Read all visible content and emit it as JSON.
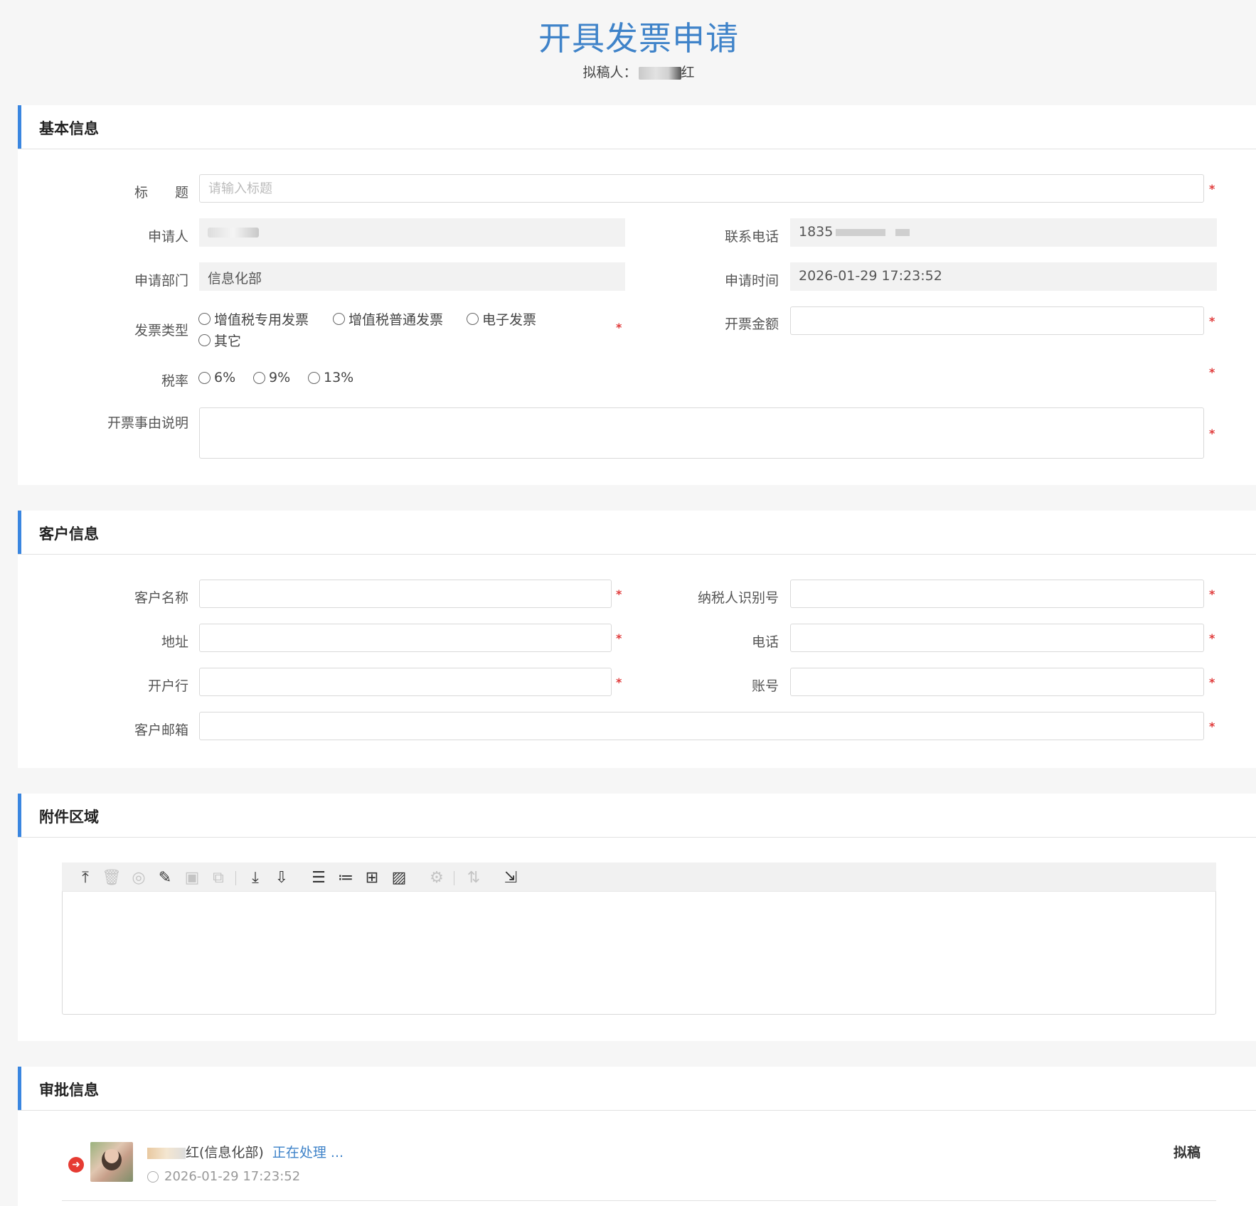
{
  "page": {
    "title": "开具发票申请",
    "drafter_label": "拟稿人：",
    "drafter_name_suffix": "红"
  },
  "basic": {
    "heading": "基本信息",
    "title_label": "标　　题",
    "title_placeholder": "请输入标题",
    "applicant_label": "申请人",
    "phone_label": "联系电话",
    "phone_value": "1835",
    "dept_label": "申请部门",
    "dept_value": "信息化部",
    "time_label": "申请时间",
    "time_value": "2026-01-29 17:23:52",
    "invoice_type_label": "发票类型",
    "invoice_types": [
      "增值税专用发票",
      "增值税普通发票",
      "电子发票",
      "其它"
    ],
    "amount_label": "开票金额",
    "tax_label": "税率",
    "tax_rates": [
      "6%",
      "9%",
      "13%"
    ],
    "reason_label": "开票事由说明"
  },
  "customer": {
    "heading": "客户信息",
    "name_label": "客户名称",
    "taxid_label": "纳税人识别号",
    "address_label": "地址",
    "phone_label": "电话",
    "bank_label": "开户行",
    "account_label": "账号",
    "email_label": "客户邮箱"
  },
  "attachments": {
    "heading": "附件区域",
    "toolbar_icons": [
      "upload-icon",
      "delete-icon",
      "preview-icon",
      "edit-icon",
      "save-icon",
      "copy-icon",
      "download-icon",
      "download-all-icon",
      "list-icon",
      "numbered-list-icon",
      "grid-icon",
      "image-icon",
      "settings-icon",
      "sort-icon",
      "minimize-icon"
    ]
  },
  "approval": {
    "heading": "审批信息",
    "dept": "(信息化部)",
    "status": "正在处理 ...",
    "time": "2026-01-29 17:23:52",
    "step": "拟稿",
    "name_suffix": "红"
  },
  "colors": {
    "title": "#3f83c9",
    "accent_bar": "#3a86e0",
    "required": "#e03a3a",
    "status_link": "#3f83c9"
  }
}
